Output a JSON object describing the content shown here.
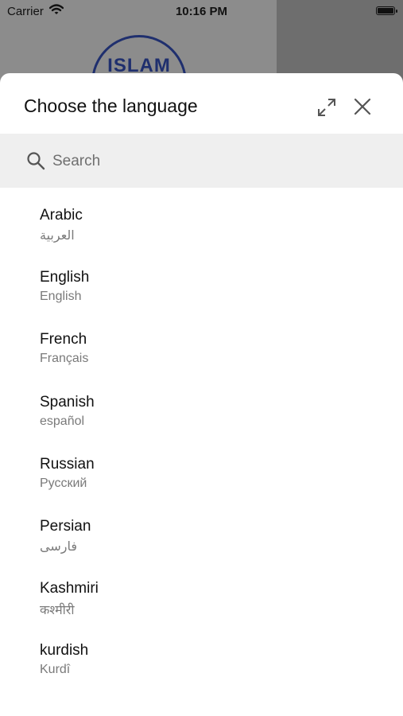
{
  "status_bar": {
    "carrier": "Carrier",
    "time": "10:16 PM"
  },
  "background": {
    "logo_text": "ISLAM"
  },
  "sheet": {
    "title": "Choose the language",
    "expand_icon": "expand-arrows-icon",
    "close_icon": "close-icon"
  },
  "search": {
    "placeholder": "Search",
    "value": ""
  },
  "languages": [
    {
      "name": "Arabic",
      "native": "العربية"
    },
    {
      "name": "English",
      "native": "English"
    },
    {
      "name": "French",
      "native": "Français"
    },
    {
      "name": "Spanish",
      "native": "español"
    },
    {
      "name": "Russian",
      "native": "Русский"
    },
    {
      "name": "Persian",
      "native": "فارسی"
    },
    {
      "name": "Kashmiri",
      "native": "कश्मीरी"
    },
    {
      "name": "kurdish",
      "native": "Kurdî"
    }
  ],
  "colors": {
    "title": "#111111",
    "secondary": "#7a7a7a",
    "search_bg": "#efefef",
    "logo": "#1f2f6e"
  }
}
